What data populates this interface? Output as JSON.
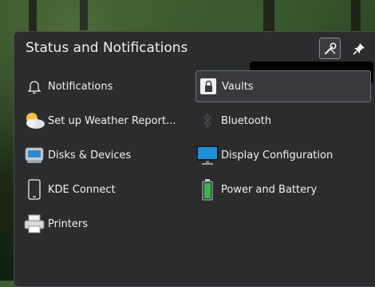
{
  "header": {
    "title": "Status and Notifications",
    "configure_icon": "configure-icon",
    "pin_icon": "pin-icon"
  },
  "items": [
    {
      "label": "Notifications",
      "icon": "bell-icon"
    },
    {
      "label": "Vaults",
      "icon": "vault-lock-icon"
    },
    {
      "label": "Set up Weather Report...",
      "icon": "weather-icon"
    },
    {
      "label": "Bluetooth",
      "icon": "bluetooth-icon"
    },
    {
      "label": "Disks & Devices",
      "icon": "disk-drive-icon"
    },
    {
      "label": "Display Configuration",
      "icon": "monitor-icon"
    },
    {
      "label": "KDE Connect",
      "icon": "phone-icon"
    },
    {
      "label": "Power and Battery",
      "icon": "battery-icon"
    },
    {
      "label": "Printers",
      "icon": "printer-icon"
    }
  ],
  "colors": {
    "panel_bg": "#2b2c2e",
    "text": "#eff0f1",
    "battery": "#3eb34a",
    "monitor": "#1e8fd6"
  }
}
